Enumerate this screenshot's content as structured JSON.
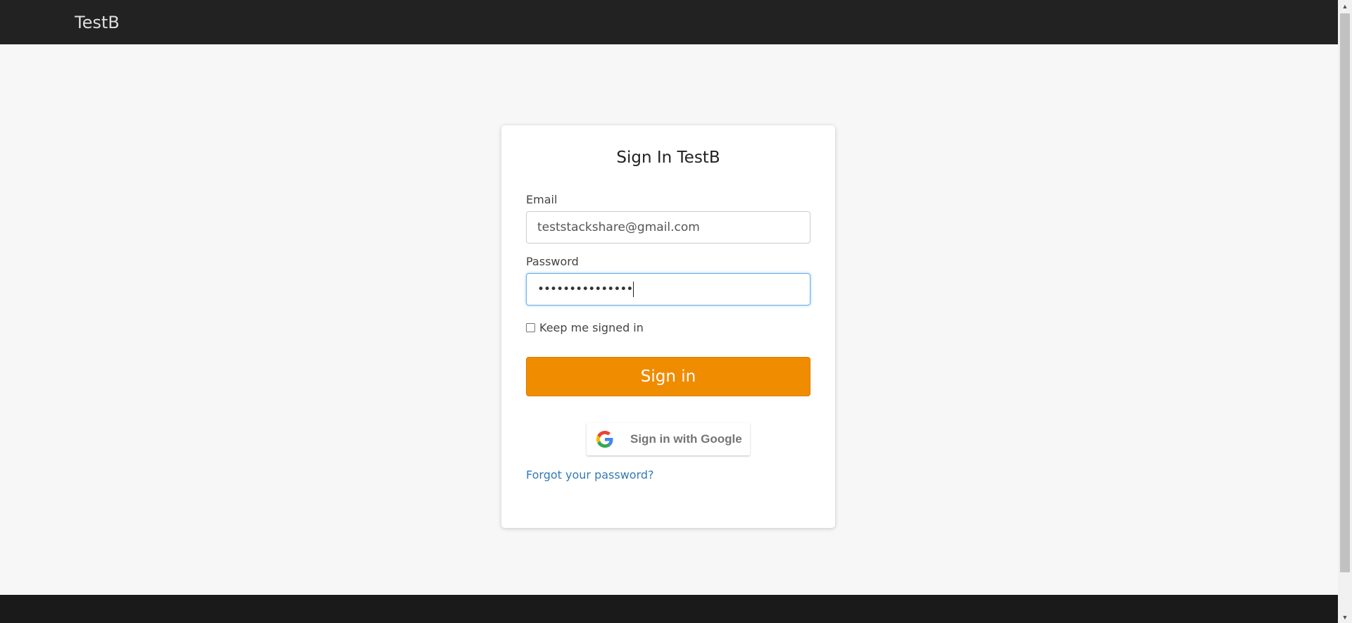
{
  "navbar": {
    "brand": "TestB"
  },
  "signin_card": {
    "title": "Sign In TestB",
    "email": {
      "label": "Email",
      "value": "teststackshare@gmail.com"
    },
    "password": {
      "label": "Password",
      "masked_value": "•••••••••••••••"
    },
    "remember": {
      "label": "Keep me signed in",
      "checked": false
    },
    "signin_button": "Sign in",
    "google_button": "Sign in with Google",
    "forgot_link": "Forgot your password?"
  },
  "colors": {
    "navbar_bg": "#222222",
    "page_bg": "#f7f7f7",
    "primary_button": "#f08c00",
    "link": "#337ab7",
    "footer_bg": "#1a1a1a"
  },
  "icons": {
    "google": "google-g-icon",
    "scroll_up": "scroll-up-arrow-icon",
    "scroll_down": "scroll-down-arrow-icon"
  }
}
